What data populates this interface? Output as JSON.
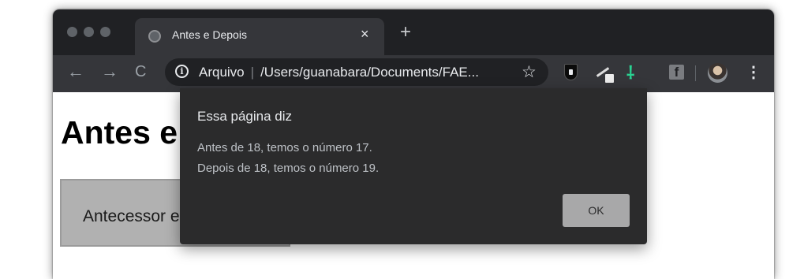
{
  "browser": {
    "tab": {
      "title": "Antes e Depois",
      "close_glyph": "×",
      "favicon": "globe-icon"
    },
    "new_tab_glyph": "+",
    "nav": {
      "back": "←",
      "forward": "→",
      "reload": "C"
    },
    "omnibox": {
      "info_glyph": "i",
      "label": "Arquivo",
      "separator": "|",
      "url": "/Users/guanabara/Documents/FAE...",
      "star_glyph": "☆"
    },
    "extensions": {
      "green_glyph": "⸸",
      "facebook_glyph": "f"
    },
    "menu_glyph": "⋮"
  },
  "page": {
    "heading": "Antes e Depois",
    "box_text": "Antecessor e Sucessor"
  },
  "dialog": {
    "title": "Essa página diz",
    "lines": [
      "Antes de 18, temos o número 17.",
      "Depois de 18, temos o número 19."
    ],
    "ok_label": "OK"
  },
  "colors": {
    "tabstrip": "#202124",
    "toolbar": "#35363a",
    "dialog_bg": "#2b2b2c",
    "ok_button": "#a8a8a9",
    "extension_green": "#29d392"
  }
}
